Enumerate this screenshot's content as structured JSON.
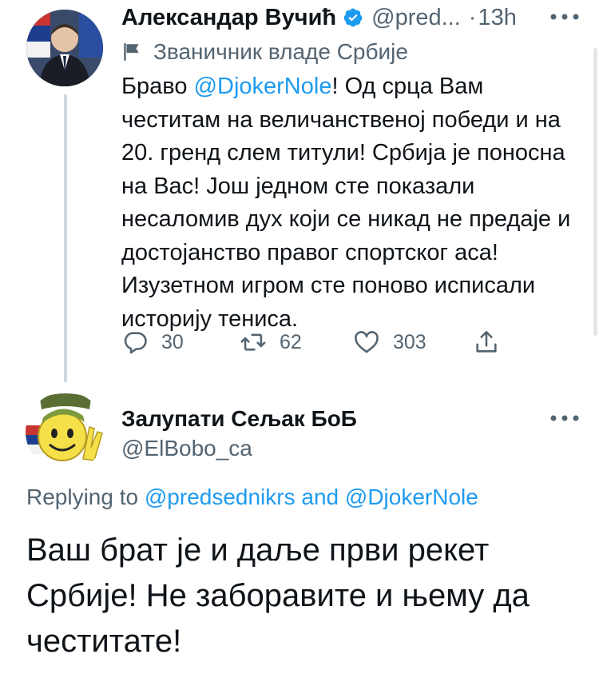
{
  "tweet": {
    "author_name": "Александар Вучић",
    "author_handle": "@pred...",
    "separator": "·",
    "time": "13h",
    "affiliation": "Званичник владе Србије",
    "body_prefix": "Браво ",
    "mention": "@DjokerNole",
    "body_rest": "! Од срца Вам честитам на величанственој победи и на 20. гренд слем титули! Србија је поносна на Вас! Још једном сте показали несаломив дух који се никад не предаје и достојанство правог спортског аса! Изузетном игром сте поново исписали историју тениса.",
    "replies": "30",
    "retweets": "62",
    "likes": "303"
  },
  "reply": {
    "author_name": "Залупати Сељак БоБ",
    "author_handle": "@ElBobo_ca",
    "replying_label": "Replying to ",
    "replying_user1": "@predsednikrs",
    "replying_and": " and ",
    "replying_user2": "@DjokerNole",
    "body": "Ваш брат је и даље први рекет Србије! Не заборавите и њему да честитате!"
  },
  "icons": {
    "verified": "verified-badge-icon",
    "flag": "government-flag-icon",
    "more": "more-dots-icon",
    "reply": "reply-icon",
    "retweet": "retweet-icon",
    "like": "heart-icon",
    "share": "share-icon"
  },
  "colors": {
    "accent": "#1d9bf0",
    "secondary_text": "#536471",
    "primary_text": "#0f1419"
  }
}
